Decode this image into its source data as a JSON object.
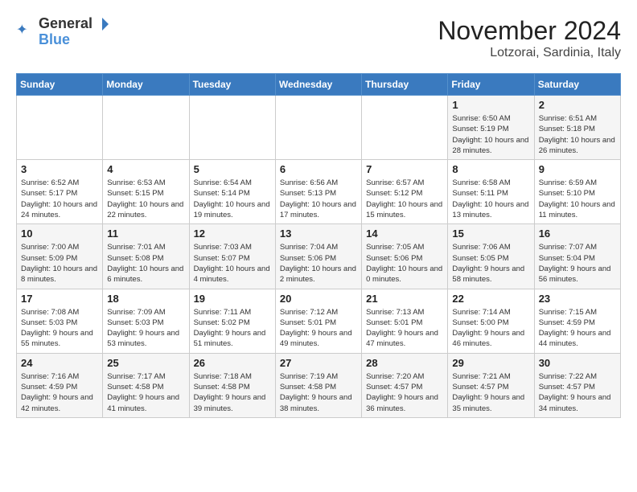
{
  "header": {
    "logo_general": "General",
    "logo_blue": "Blue",
    "title": "November 2024",
    "subtitle": "Lotzorai, Sardinia, Italy"
  },
  "weekdays": [
    "Sunday",
    "Monday",
    "Tuesday",
    "Wednesday",
    "Thursday",
    "Friday",
    "Saturday"
  ],
  "weeks": [
    [
      {
        "day": "",
        "text": ""
      },
      {
        "day": "",
        "text": ""
      },
      {
        "day": "",
        "text": ""
      },
      {
        "day": "",
        "text": ""
      },
      {
        "day": "",
        "text": ""
      },
      {
        "day": "1",
        "text": "Sunrise: 6:50 AM\nSunset: 5:19 PM\nDaylight: 10 hours and 28 minutes."
      },
      {
        "day": "2",
        "text": "Sunrise: 6:51 AM\nSunset: 5:18 PM\nDaylight: 10 hours and 26 minutes."
      }
    ],
    [
      {
        "day": "3",
        "text": "Sunrise: 6:52 AM\nSunset: 5:17 PM\nDaylight: 10 hours and 24 minutes."
      },
      {
        "day": "4",
        "text": "Sunrise: 6:53 AM\nSunset: 5:15 PM\nDaylight: 10 hours and 22 minutes."
      },
      {
        "day": "5",
        "text": "Sunrise: 6:54 AM\nSunset: 5:14 PM\nDaylight: 10 hours and 19 minutes."
      },
      {
        "day": "6",
        "text": "Sunrise: 6:56 AM\nSunset: 5:13 PM\nDaylight: 10 hours and 17 minutes."
      },
      {
        "day": "7",
        "text": "Sunrise: 6:57 AM\nSunset: 5:12 PM\nDaylight: 10 hours and 15 minutes."
      },
      {
        "day": "8",
        "text": "Sunrise: 6:58 AM\nSunset: 5:11 PM\nDaylight: 10 hours and 13 minutes."
      },
      {
        "day": "9",
        "text": "Sunrise: 6:59 AM\nSunset: 5:10 PM\nDaylight: 10 hours and 11 minutes."
      }
    ],
    [
      {
        "day": "10",
        "text": "Sunrise: 7:00 AM\nSunset: 5:09 PM\nDaylight: 10 hours and 8 minutes."
      },
      {
        "day": "11",
        "text": "Sunrise: 7:01 AM\nSunset: 5:08 PM\nDaylight: 10 hours and 6 minutes."
      },
      {
        "day": "12",
        "text": "Sunrise: 7:03 AM\nSunset: 5:07 PM\nDaylight: 10 hours and 4 minutes."
      },
      {
        "day": "13",
        "text": "Sunrise: 7:04 AM\nSunset: 5:06 PM\nDaylight: 10 hours and 2 minutes."
      },
      {
        "day": "14",
        "text": "Sunrise: 7:05 AM\nSunset: 5:06 PM\nDaylight: 10 hours and 0 minutes."
      },
      {
        "day": "15",
        "text": "Sunrise: 7:06 AM\nSunset: 5:05 PM\nDaylight: 9 hours and 58 minutes."
      },
      {
        "day": "16",
        "text": "Sunrise: 7:07 AM\nSunset: 5:04 PM\nDaylight: 9 hours and 56 minutes."
      }
    ],
    [
      {
        "day": "17",
        "text": "Sunrise: 7:08 AM\nSunset: 5:03 PM\nDaylight: 9 hours and 55 minutes."
      },
      {
        "day": "18",
        "text": "Sunrise: 7:09 AM\nSunset: 5:03 PM\nDaylight: 9 hours and 53 minutes."
      },
      {
        "day": "19",
        "text": "Sunrise: 7:11 AM\nSunset: 5:02 PM\nDaylight: 9 hours and 51 minutes."
      },
      {
        "day": "20",
        "text": "Sunrise: 7:12 AM\nSunset: 5:01 PM\nDaylight: 9 hours and 49 minutes."
      },
      {
        "day": "21",
        "text": "Sunrise: 7:13 AM\nSunset: 5:01 PM\nDaylight: 9 hours and 47 minutes."
      },
      {
        "day": "22",
        "text": "Sunrise: 7:14 AM\nSunset: 5:00 PM\nDaylight: 9 hours and 46 minutes."
      },
      {
        "day": "23",
        "text": "Sunrise: 7:15 AM\nSunset: 4:59 PM\nDaylight: 9 hours and 44 minutes."
      }
    ],
    [
      {
        "day": "24",
        "text": "Sunrise: 7:16 AM\nSunset: 4:59 PM\nDaylight: 9 hours and 42 minutes."
      },
      {
        "day": "25",
        "text": "Sunrise: 7:17 AM\nSunset: 4:58 PM\nDaylight: 9 hours and 41 minutes."
      },
      {
        "day": "26",
        "text": "Sunrise: 7:18 AM\nSunset: 4:58 PM\nDaylight: 9 hours and 39 minutes."
      },
      {
        "day": "27",
        "text": "Sunrise: 7:19 AM\nSunset: 4:58 PM\nDaylight: 9 hours and 38 minutes."
      },
      {
        "day": "28",
        "text": "Sunrise: 7:20 AM\nSunset: 4:57 PM\nDaylight: 9 hours and 36 minutes."
      },
      {
        "day": "29",
        "text": "Sunrise: 7:21 AM\nSunset: 4:57 PM\nDaylight: 9 hours and 35 minutes."
      },
      {
        "day": "30",
        "text": "Sunrise: 7:22 AM\nSunset: 4:57 PM\nDaylight: 9 hours and 34 minutes."
      }
    ]
  ]
}
